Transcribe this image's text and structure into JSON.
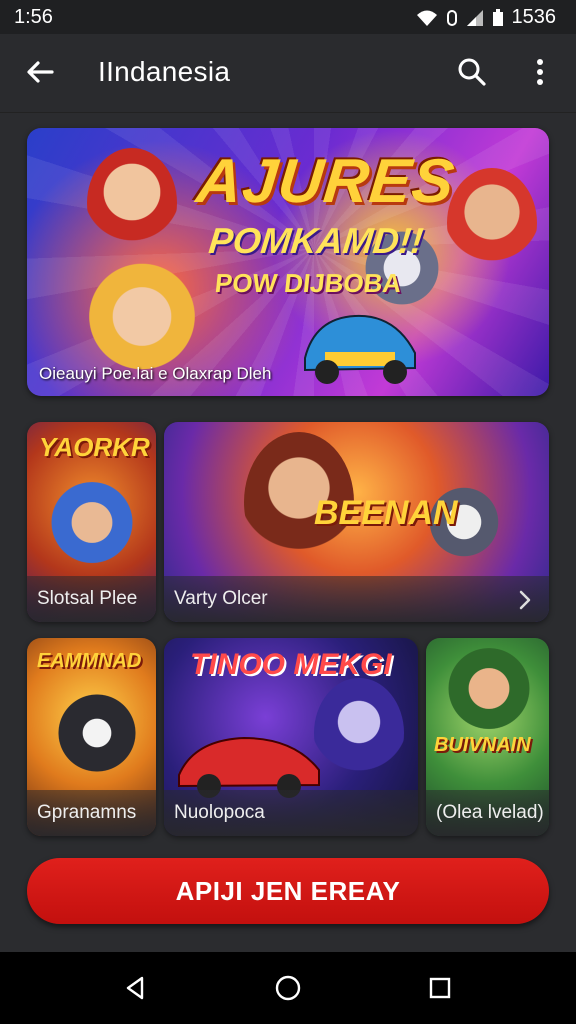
{
  "status_bar": {
    "time": "1:56",
    "right_text": "1536"
  },
  "app_bar": {
    "title": "IIndanesia"
  },
  "hero": {
    "title": "AJURES",
    "subtitle1": "POMKAMD!!",
    "subtitle2": "POW DIJBOBA",
    "caption": "Oieauyi Poe.lai e Olaxrap Dleh"
  },
  "tiles": [
    {
      "label": "Slotsal Plee",
      "banner": "YAORKR"
    },
    {
      "label": "Varty Olcer",
      "banner": "BEENAN"
    },
    {
      "label": "Gpranamns",
      "banner": "EAMMNAD"
    },
    {
      "label": "Nuolopoca",
      "banner": "TINOO MEKGI"
    },
    {
      "label": "(Olea lvelad)",
      "banner": "BUIVNAIN"
    }
  ],
  "cta": {
    "label": "APIJI JEN EREAY"
  },
  "colors": {
    "cta": "#d0140f",
    "background": "#2b2c2f"
  }
}
